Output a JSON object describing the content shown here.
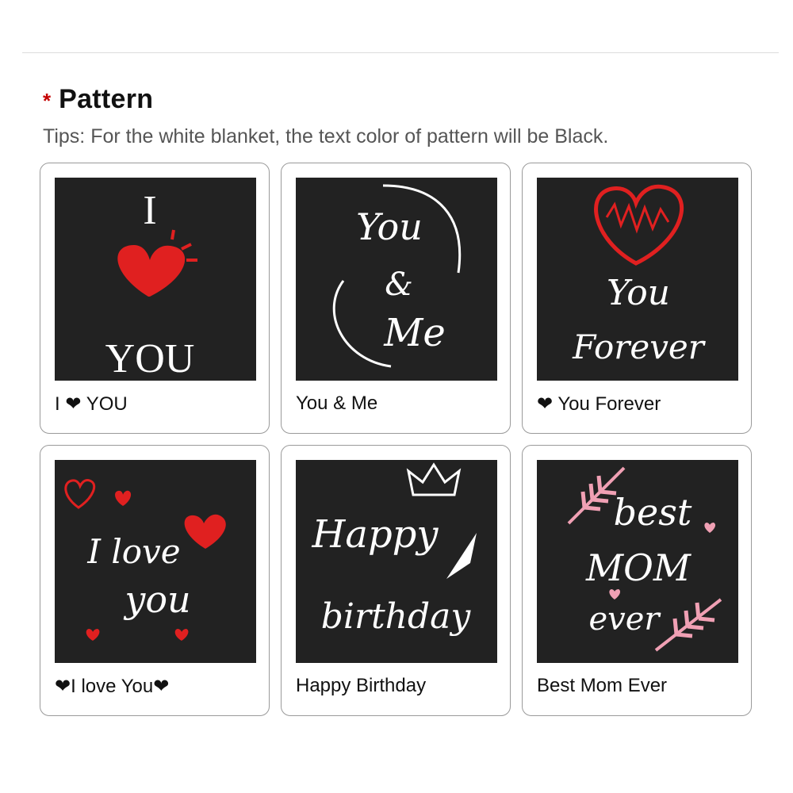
{
  "header": {
    "required_mark": "*",
    "title": "Pattern",
    "tips": "Tips: For the white blanket, the text color of pattern will be Black."
  },
  "patterns": [
    {
      "label_pre": "I ",
      "label_heart": "❤",
      "label_post": " YOU",
      "art_lines": [
        "I",
        "YOU"
      ]
    },
    {
      "label_pre": "You & Me",
      "label_heart": "",
      "label_post": "",
      "art_lines": [
        "You",
        "&",
        "Me"
      ]
    },
    {
      "label_pre": "",
      "label_heart": "❤",
      "label_post": " You Forever",
      "art_lines": [
        "You",
        "Forever"
      ]
    },
    {
      "label_pre": "❤I love You❤",
      "label_heart": "",
      "label_post": "",
      "art_lines": [
        "I love",
        "you"
      ]
    },
    {
      "label_pre": "Happy Birthday",
      "label_heart": "",
      "label_post": "",
      "art_lines": [
        "Happy",
        "birthday"
      ]
    },
    {
      "label_pre": "Best Mom Ever",
      "label_heart": "",
      "label_post": "",
      "art_lines": [
        "best",
        "MOM",
        "ever"
      ]
    }
  ],
  "colors": {
    "accent_red": "#e02020",
    "pink": "#f0a0b4",
    "thumb_bg": "#222222"
  }
}
